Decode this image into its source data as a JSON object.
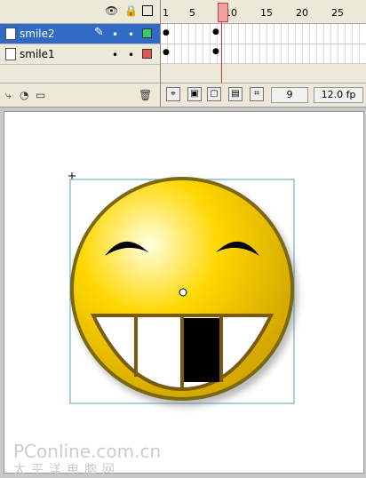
{
  "timeline": {
    "layers": [
      {
        "name": "smile2",
        "selected": true,
        "color": "#33cc66"
      },
      {
        "name": "smile1",
        "selected": false,
        "color": "#e05555"
      }
    ],
    "ruler_ticks": [
      "1",
      "5",
      "10",
      "15",
      "20",
      "25"
    ],
    "current_frame": "9",
    "frame_rate": "12.0 fp"
  },
  "watermark": {
    "line1": "PConline.com.cn",
    "line2": "太平洋电脑网"
  },
  "icons": {
    "eye": "eye-icon",
    "lock": "lock-icon",
    "outline": "outline-icon",
    "pencil": "pencil-icon",
    "trash": "trash-icon"
  }
}
